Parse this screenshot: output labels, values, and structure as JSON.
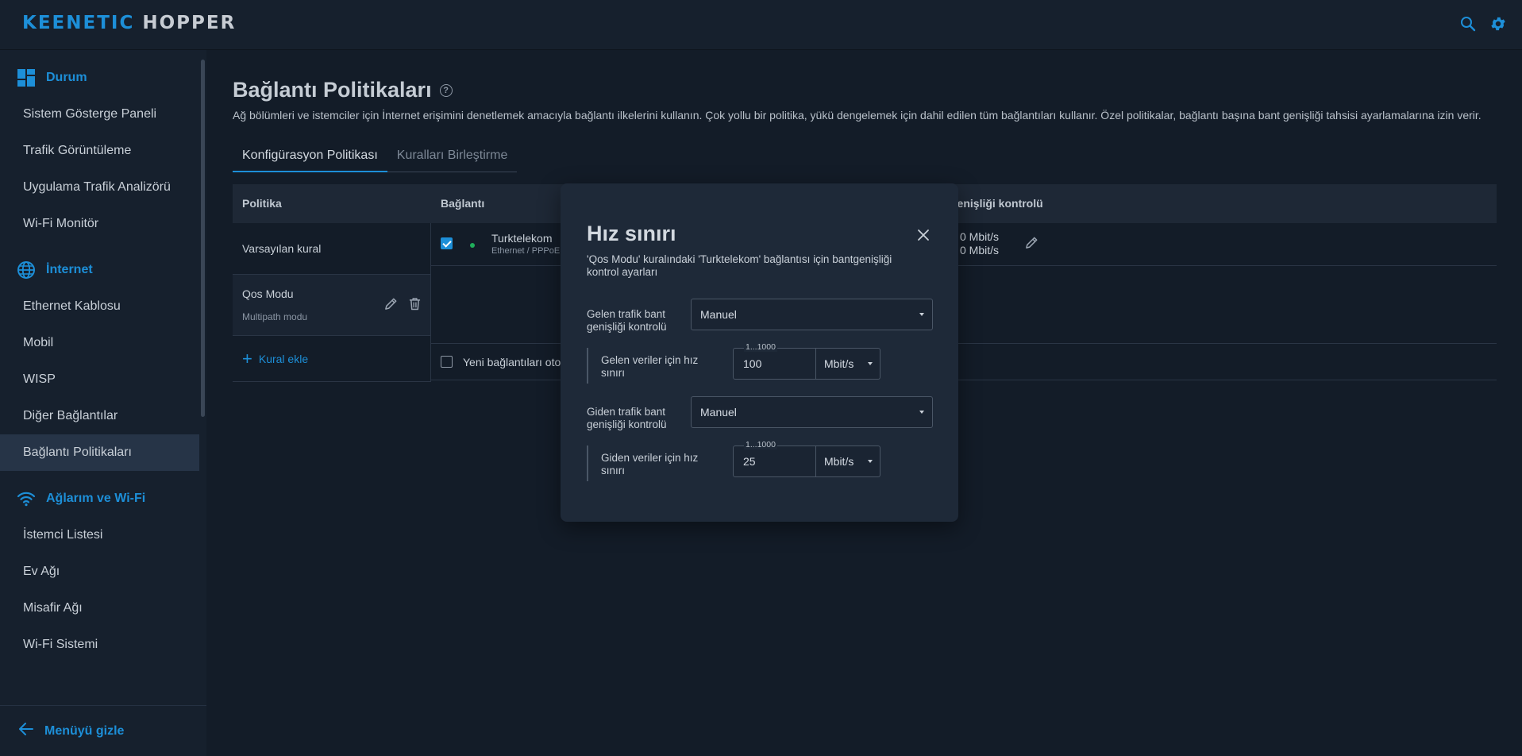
{
  "brand": {
    "part1": "KEENETIC",
    "part2": "HOPPER"
  },
  "header": {
    "search_icon": "search-icon",
    "settings_icon": "gear-icon"
  },
  "sidebar": {
    "sections": [
      {
        "title": "Durum",
        "icon": "dashboard-icon",
        "items": [
          "Sistem Gösterge Paneli",
          "Trafik Görüntüleme",
          "Uygulama Trafik Analizörü",
          "Wi-Fi Monitör"
        ]
      },
      {
        "title": "İnternet",
        "icon": "globe-icon",
        "items": [
          "Ethernet Kablosu",
          "Mobil",
          "WISP",
          "Diğer Bağlantılar",
          "Bağlantı Politikaları"
        ]
      },
      {
        "title": "Ağlarım ve Wi-Fi",
        "icon": "wifi-icon",
        "items": [
          "İstemci Listesi",
          "Ev Ağı",
          "Misafir Ağı",
          "Wi-Fi Sistemi"
        ]
      }
    ],
    "active_item": "Bağlantı Politikaları",
    "footer": "Menüyü gizle"
  },
  "page": {
    "title": "Bağlantı Politikaları",
    "description": "Ağ bölümleri ve istemciler için İnternet erişimini denetlemek amacıyla bağlantı ilkelerini kullanın. Çok yollu bir politika, yükü dengelemek için dahil edilen tüm bağlantıları kullanır. Özel politikalar, bağlantı başına bant genişliği tahsisi ayarlamalarına izin verir.",
    "tabs": [
      "Konfigürasyon Politikası",
      "Kuralları Birleştirme"
    ],
    "active_tab": "Konfigürasyon Politikası"
  },
  "table": {
    "headers": {
      "policy": "Politika",
      "connection": "Bağlantı",
      "bandwidth": "genişliği kontrolü"
    },
    "policies": [
      {
        "name": "Varsayılan kural",
        "sub": ""
      },
      {
        "name": "Qos Modu",
        "sub": "Multipath modu"
      }
    ],
    "add_rule": "Kural ekle",
    "connection": {
      "name": "Turktelekom",
      "type": "Ethernet / PPPoE",
      "bw_in": "0 Mbit/s",
      "bw_out": "0 Mbit/s"
    },
    "auto_new": "Yeni bağlantıları oto"
  },
  "modal": {
    "title": "Hız sınırı",
    "description": "'Qos Modu' kuralındaki 'Turktelekom' bağlantısı için bantgenişliği kontrol ayarları",
    "incoming": {
      "label": "Gelen trafik bant genişliği kontrolü",
      "mode": "Manuel",
      "limit_label": "Gelen veriler için hız sınırı",
      "range": "1...1000",
      "value": "100",
      "unit": "Mbit/s"
    },
    "outgoing": {
      "label": "Giden trafik bant genişliği kontrolü",
      "mode": "Manuel",
      "limit_label": "Giden veriler için hız sınırı",
      "range": "1...1000",
      "value": "25",
      "unit": "Mbit/s"
    }
  },
  "colors": {
    "accent": "#1d8fd8",
    "background": "#131c28",
    "panel": "#16202d",
    "status_ok": "#1fae5b"
  }
}
